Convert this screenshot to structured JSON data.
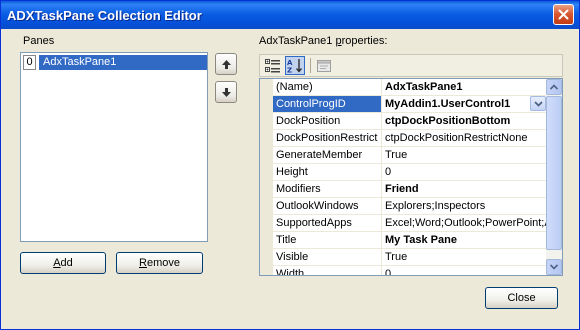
{
  "window": {
    "title": "ADXTaskPane Collection Editor"
  },
  "panes": {
    "label": "Panes",
    "items": [
      {
        "index": "0",
        "text": "AdxTaskPane1"
      }
    ]
  },
  "properties": {
    "label_prefix": "AdxTaskPane1 ",
    "label_accel": "p",
    "label_suffix": "roperties:",
    "rows": [
      {
        "name": "(Name)",
        "value": "AdxTaskPane1",
        "bold": true
      },
      {
        "name": "ControlProgID",
        "value": "MyAddin1.UserControl1",
        "bold": true,
        "selected": true
      },
      {
        "name": "DockPosition",
        "value": "ctpDockPositionBottom",
        "bold": true
      },
      {
        "name": "DockPositionRestrict",
        "value": "ctpDockPositionRestrictNone",
        "bold": false
      },
      {
        "name": "GenerateMember",
        "value": "True",
        "bold": false
      },
      {
        "name": "Height",
        "value": "0",
        "bold": false
      },
      {
        "name": "Modifiers",
        "value": "Friend",
        "bold": true
      },
      {
        "name": "OutlookWindows",
        "value": "Explorers;Inspectors",
        "bold": false
      },
      {
        "name": "SupportedApps",
        "value": "Excel;Word;Outlook;PowerPoint;Access",
        "bold": false
      },
      {
        "name": "Title",
        "value": "My Task Pane",
        "bold": true
      },
      {
        "name": "Visible",
        "value": "True",
        "bold": false
      },
      {
        "name": "Width",
        "value": "0",
        "bold": false
      }
    ]
  },
  "buttons": {
    "add_accel": "A",
    "add_rest": "dd",
    "remove_accel": "R",
    "remove_rest": "emove",
    "close": "Close"
  },
  "icons": {
    "close": "close-icon",
    "move_up": "arrow-up-icon",
    "move_down": "arrow-down-icon",
    "categorized": "categorized-icon",
    "alphabetical": "alphabetical-icon",
    "property_pages": "property-pages-icon"
  },
  "colors": {
    "title_bar": "#0b5de3",
    "selection": "#316ac5",
    "dialog_bg": "#ece9d8"
  }
}
